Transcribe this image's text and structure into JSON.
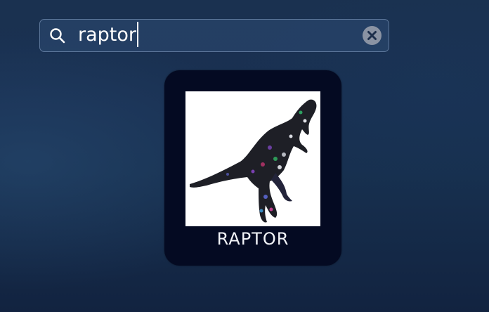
{
  "search": {
    "query": "raptor",
    "search_icon": "search-icon",
    "clear_icon": "clear-circle-x-icon"
  },
  "results": [
    {
      "label": "RAPTOR",
      "icon": "raptor-dinosaur-icon"
    }
  ],
  "colors": {
    "background": "#17304f",
    "tile_background": "#040a22",
    "text": "#ffffff"
  }
}
